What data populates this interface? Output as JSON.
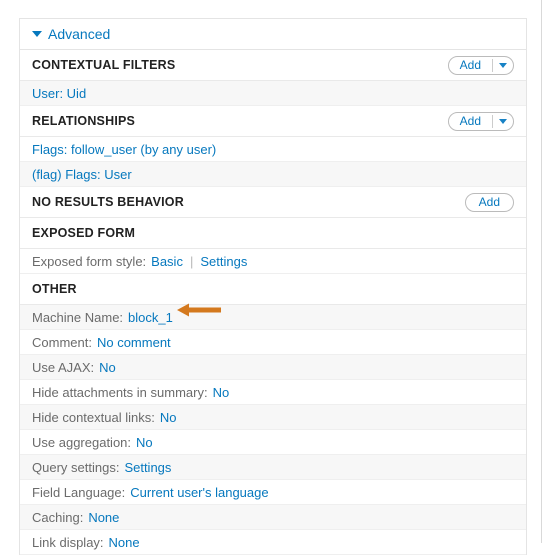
{
  "colors": {
    "link": "#0678be",
    "annotation_arrow": "#d4791e",
    "stripe": "#f7f7f7",
    "border": "#e4e4e4"
  },
  "advanced": {
    "label": "Advanced",
    "toggle_icon": "caret-down-icon",
    "expanded": true
  },
  "sections": [
    {
      "title": "CONTEXTUAL FILTERS",
      "add_label": "Add",
      "has_dropdown": true,
      "items": [
        "User: Uid"
      ]
    },
    {
      "title": "RELATIONSHIPS",
      "add_label": "Add",
      "has_dropdown": true,
      "items": [
        "Flags: follow_user (by any user)",
        "(flag) Flags: User"
      ]
    },
    {
      "title": "NO RESULTS BEHAVIOR",
      "add_label": "Add",
      "has_dropdown": false,
      "items": []
    },
    {
      "title": "EXPOSED FORM",
      "add_label": "",
      "has_dropdown": false,
      "items": []
    },
    {
      "title": "OTHER",
      "add_label": "",
      "has_dropdown": false,
      "items": []
    }
  ],
  "exposed_form": {
    "label": "Exposed form style:",
    "style_value": "Basic",
    "separator": "|",
    "settings_label": "Settings"
  },
  "other_rows": [
    {
      "label": "Machine Name:",
      "value": "block_1",
      "annotated": true
    },
    {
      "label": "Comment:",
      "value": "No comment",
      "annotated": false
    },
    {
      "label": "Use AJAX:",
      "value": "No",
      "annotated": false
    },
    {
      "label": "Hide attachments in summary:",
      "value": "No",
      "annotated": false
    },
    {
      "label": "Hide contextual links:",
      "value": "No",
      "annotated": false
    },
    {
      "label": "Use aggregation:",
      "value": "No",
      "annotated": false
    },
    {
      "label": "Query settings:",
      "value": "Settings",
      "annotated": false
    },
    {
      "label": "Field Language:",
      "value": "Current user's language",
      "annotated": false
    },
    {
      "label": "Caching:",
      "value": "None",
      "annotated": false
    },
    {
      "label": "Link display:",
      "value": "None",
      "annotated": false
    }
  ],
  "annotation": {
    "icon": "arrow-left-icon",
    "points_to": "block_1"
  }
}
